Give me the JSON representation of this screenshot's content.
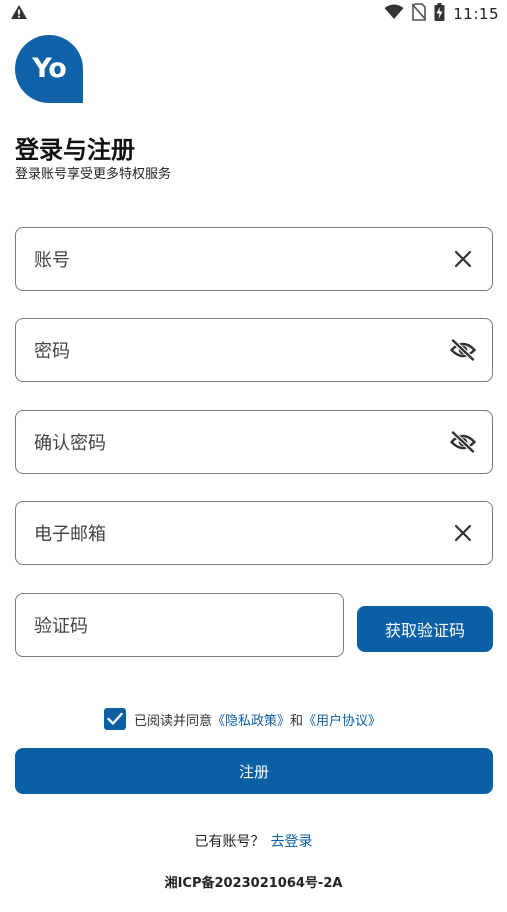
{
  "status_bar": {
    "time": "11:15",
    "icons": [
      "warning-icon",
      "wifi-icon",
      "no-sim-icon",
      "battery-charging-icon"
    ]
  },
  "logo": {
    "text": "Yo"
  },
  "header": {
    "title": "登录与注册",
    "subtitle": "登录账号享受更多特权服务"
  },
  "form": {
    "account": {
      "placeholder": "账号",
      "icon": "clear-icon"
    },
    "password": {
      "placeholder": "密码",
      "icon": "eye-off-icon"
    },
    "confirm_password": {
      "placeholder": "确认密码",
      "icon": "eye-off-icon"
    },
    "email": {
      "placeholder": "电子邮箱",
      "icon": "clear-icon"
    },
    "code": {
      "placeholder": "验证码"
    },
    "get_code_label": "获取验证码"
  },
  "agreement": {
    "checked": true,
    "prefix": "已阅读并同意",
    "privacy_link": "《隐私政策》",
    "and": "和",
    "user_link": "《用户协议》"
  },
  "register_label": "注册",
  "login_prompt": {
    "text": "已有账号？",
    "link": "去登录"
  },
  "icp": "湘ICP备2023021064号-2A",
  "colors": {
    "primary": "#0b5fa5",
    "logo": "#1062a8"
  }
}
